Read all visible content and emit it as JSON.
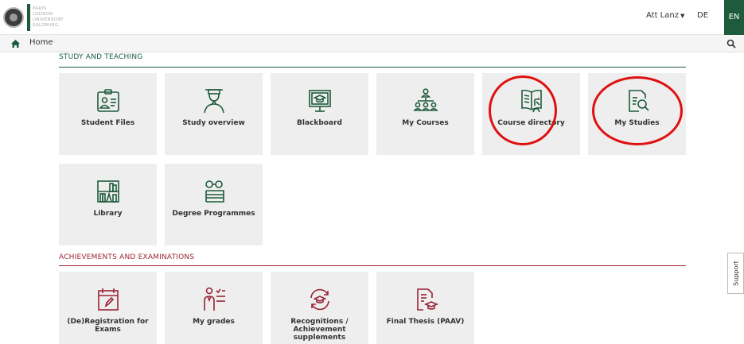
{
  "header": {
    "logo_lines": [
      "PARIS",
      "LODRON",
      "UNIVERSITÄT",
      "SALZBURG"
    ],
    "user_name": "Att Lanz",
    "lang_de": "DE",
    "lang_en": "EN",
    "accent_color": "#1e5b3c",
    "exam_color": "#9b2334"
  },
  "nav": {
    "home_label": "Home"
  },
  "sections": {
    "study": {
      "title": "Study and teaching",
      "tiles": [
        {
          "label": "Student Files",
          "icon": "student-files-icon"
        },
        {
          "label": "Study overview",
          "icon": "graduate-icon"
        },
        {
          "label": "Blackboard",
          "icon": "blackboard-icon"
        },
        {
          "label": "My Courses",
          "icon": "courses-icon"
        },
        {
          "label": "Course directory",
          "icon": "book-directory-icon"
        },
        {
          "label": "My Studies",
          "icon": "document-search-icon"
        },
        {
          "label": "Library",
          "icon": "library-icon"
        },
        {
          "label": "Degree Programmes",
          "icon": "degree-programmes-icon"
        }
      ]
    },
    "exams": {
      "title": "Achievements and examinations",
      "tiles": [
        {
          "label": "(De)Registration for Exams",
          "icon": "calendar-edit-icon"
        },
        {
          "label": "My grades",
          "icon": "grades-icon"
        },
        {
          "label": "Recognitions / Achievement supplements",
          "icon": "recognition-icon"
        },
        {
          "label": "Final Thesis (PAAV)",
          "icon": "thesis-icon"
        }
      ]
    }
  },
  "support_label": "Support"
}
